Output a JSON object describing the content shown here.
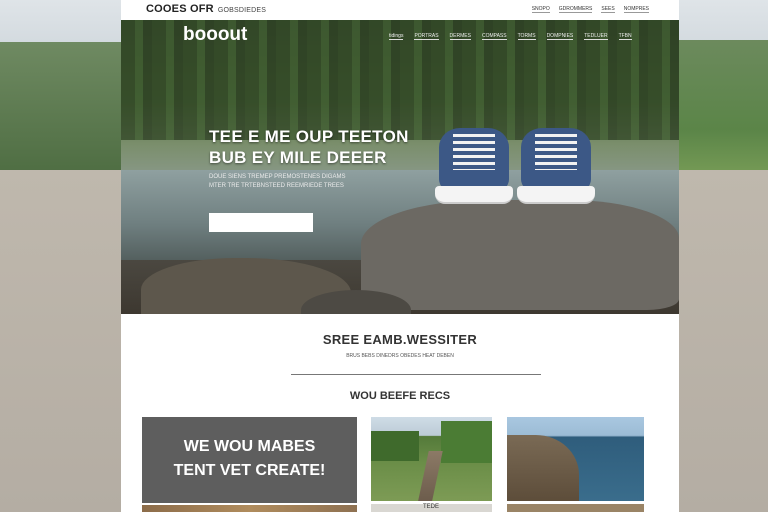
{
  "topbar": {
    "brand": "COOES OFR",
    "brand_sub": "GOBSDIEDES",
    "links": [
      "SNOPO",
      "GDROMMERS",
      "SEES",
      "NOMPRES"
    ]
  },
  "hero": {
    "logo": "booout",
    "nav": [
      "tidings",
      "PORTRAS",
      "DERMES",
      "COMPASS",
      "TORMS",
      "DOMPNIES",
      "TEDLUER",
      "TFBN"
    ],
    "headline_1": "TEE E ME OUP TEETON",
    "headline_2": "BUB EY MILE DEEER",
    "tagline_1": "DOUE SIENS TREMEP PREMOSTENES DIGAMS",
    "tagline_2": "MTER TRE TRTEBNSTEED REEMRIEDE TREES",
    "search_value": ""
  },
  "feature": {
    "title": "SREE EAMB.WESSITER",
    "subtitle": "BRUS BEBS DINEDRS OBEDES HEAT DEBEN",
    "works_title": "WOU BEEFE RECS",
    "card_caption_1": "WE WOU MABES",
    "card_caption_2": "TENT VET CREATE!",
    "card2_label": "TEDE"
  },
  "colors": {
    "hero_text": "#ffffff",
    "card_dark": "#5e5e5e",
    "shoe_blue": "#3c5886"
  }
}
